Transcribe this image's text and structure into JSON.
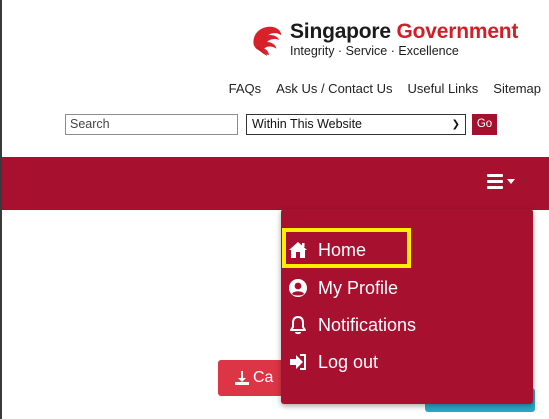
{
  "header": {
    "logo_title_main": "Singapore",
    "logo_title_accent": "Government",
    "logo_tagline": "Integrity · Service · Excellence",
    "links": [
      "FAQs",
      "Ask Us / Contact Us",
      "Useful Links",
      "Sitemap"
    ]
  },
  "search": {
    "placeholder": "Search",
    "scope_selected": "Within This Website",
    "go_label": "Go"
  },
  "background": {
    "red_button_text": "Ca"
  },
  "menu": {
    "items": [
      {
        "label": "Home",
        "icon": "home-icon"
      },
      {
        "label": "My Profile",
        "icon": "user-circle-icon"
      },
      {
        "label": "Notifications",
        "icon": "bell-icon"
      },
      {
        "label": "Log out",
        "icon": "logout-icon"
      }
    ]
  },
  "colors": {
    "brand_red": "#a8102f",
    "highlight": "#ffee00",
    "accent_red": "#cf2027"
  }
}
